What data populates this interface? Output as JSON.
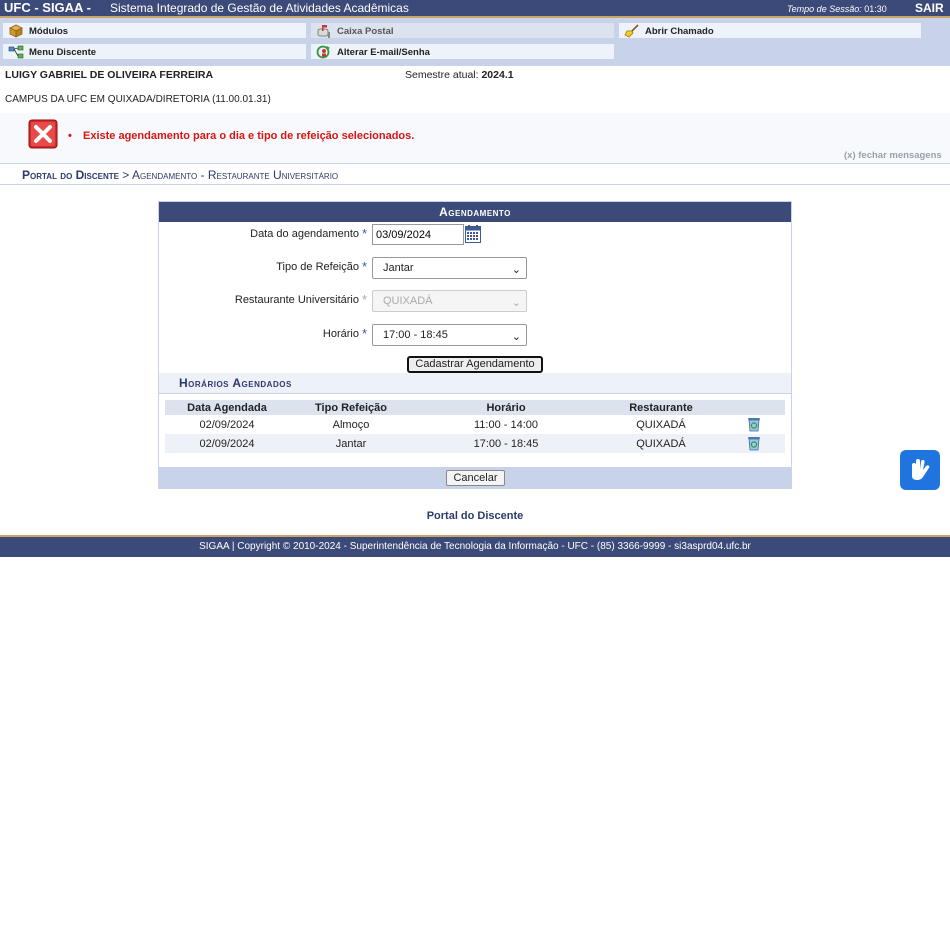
{
  "topbar": {
    "brand": "UFC - SIGAA -",
    "system_name": "Sistema Integrado de Gestão de Atividades Acadêmicas",
    "session_label": "Tempo de Sessão:",
    "session_time": "01:30",
    "logout": "SAIR"
  },
  "menu": {
    "modulos": "Módulos",
    "caixa_postal": "Caixa Postal",
    "abrir_chamado": "Abrir Chamado",
    "menu_discente": "Menu Discente",
    "alterar_email": "Alterar E-mail/Senha"
  },
  "user": {
    "name": "LUIGY GABRIEL DE OLIVEIRA FERREIRA",
    "semester_label": "Semestre atual:",
    "semester": "2024.1",
    "campus": "CAMPUS DA UFC EM QUIXADA/DIRETORIA (11.00.01.31)"
  },
  "messages": {
    "error": "Existe agendamento para o dia e tipo de refeição selecionados.",
    "close": "(x) fechar mensagens"
  },
  "breadcrumb": {
    "portal": "Portal do Discente",
    "separator": " > ",
    "current": "Agendamento - Restaurante Universitário"
  },
  "form": {
    "title": "Agendamento",
    "required_mark": "*",
    "date_label": "Data do agendamento",
    "date_value": "03/09/2024",
    "meal_label": "Tipo de Refeição",
    "meal_value": "Jantar",
    "restaurant_label": "Restaurante Universitário",
    "restaurant_value": "QUIXADÁ",
    "time_label": "Horário",
    "time_value": "17:00 - 18:45",
    "submit": "Cadastrar Agendamento",
    "cancel": "Cancelar"
  },
  "history": {
    "title": "Horários Agendados",
    "columns": [
      "Data Agendada",
      "Tipo Refeição",
      "Horário",
      "Restaurante"
    ],
    "rows": [
      {
        "date": "02/09/2024",
        "meal": "Almoço",
        "time": "11:00 - 14:00",
        "restaurant": "QUIXADÁ"
      },
      {
        "date": "02/09/2024",
        "meal": "Jantar",
        "time": "17:00 - 18:45",
        "restaurant": "QUIXADÁ"
      }
    ]
  },
  "portal_link": "Portal do Discente",
  "footer": "SIGAA | Copyright © 2010-2024 - Superintendência de Tecnologia da Informação - UFC - (85) 3366-9999 - si3asprd04.ufc.br",
  "colors": {
    "header": "#3b4a78",
    "accent_border": "#c9a56a",
    "menu_bg": "#c8d3ea",
    "error_text": "#d81515",
    "link": "#2b3a6b"
  }
}
